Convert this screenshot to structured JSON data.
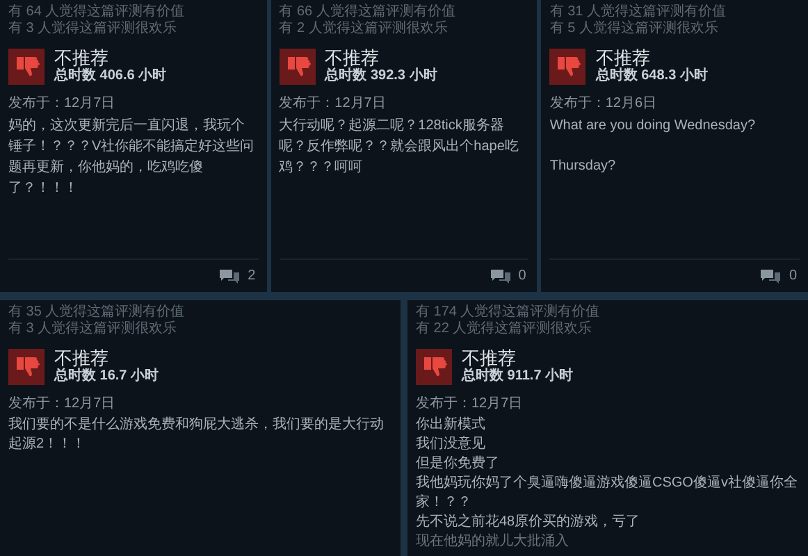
{
  "rows": [
    [
      {
        "helpful": "有 64 人觉得这篇评测有价值",
        "funny": "有 3 人觉得这篇评测很欢乐",
        "verdict": "不推荐",
        "hours": "总时数 406.6 小时",
        "posted": "发布于：12月7日",
        "paragraphs": [
          "妈的，这次更新完后一直闪退，我玩个锤子！？？？V社你能不能搞定好这些问题再更新，你他妈的，吃鸡吃傻了？！！！"
        ],
        "comments": "2"
      },
      {
        "helpful": "有 66 人觉得这篇评测有价值",
        "funny": "有 2 人觉得这篇评测很欢乐",
        "verdict": "不推荐",
        "hours": "总时数 392.3 小时",
        "posted": "发布于：12月7日",
        "paragraphs": [
          "大行动呢？起源二呢？128tick服务器呢？反作弊呢？？就会跟风出个hape吃鸡？？？呵呵"
        ],
        "comments": "0"
      },
      {
        "helpful": "有 31 人觉得这篇评测有价值",
        "funny": "有 5 人觉得这篇评测很欢乐",
        "verdict": "不推荐",
        "hours": "总时数 648.3 小时",
        "posted": "发布于：12月6日",
        "paragraphs": [
          "What are you doing Wednesday?",
          "Thursday?"
        ],
        "paragraph_gap": true,
        "comments": "0"
      }
    ],
    [
      {
        "helpful": "有 35 人觉得这篇评测有价值",
        "funny": "有 3 人觉得这篇评测很欢乐",
        "verdict": "不推荐",
        "hours": "总时数 16.7 小时",
        "posted": "发布于：12月7日",
        "paragraphs": [
          "我们要的不是什么游戏免费和狗屁大逃杀，我们要的是大行动起源2！！！"
        ]
      },
      {
        "helpful": "有 174 人觉得这篇评测有价值",
        "funny": "有 22 人觉得这篇评测很欢乐",
        "verdict": "不推荐",
        "hours": "总时数 911.7 小时",
        "posted": "发布于：12月7日",
        "paragraphs": [
          "你出新模式",
          "我们没意见",
          "但是你免费了",
          "我他妈玩你妈了个臭逼嗨傻逼游戏傻逼CSGO傻逼v社傻逼你全家！？？",
          "先不说之前花48原价买的游戏，亏了",
          "现在他妈的就儿大批涌入"
        ]
      }
    ]
  ]
}
